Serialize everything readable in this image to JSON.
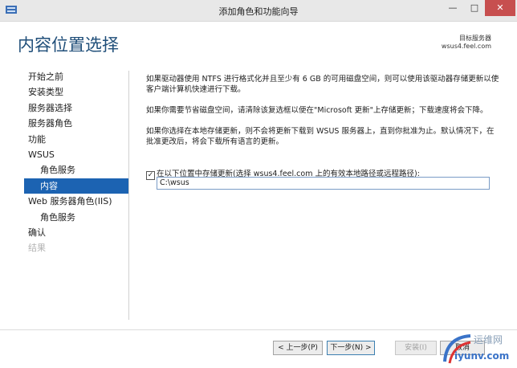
{
  "window": {
    "title": "添加角色和功能向导",
    "controls": {
      "minimize": "—",
      "maximize": "□",
      "close": "✕"
    }
  },
  "header": {
    "page_title": "内容位置选择",
    "destination_label": "目标服务器",
    "destination_server": "wsus4.feel.com"
  },
  "nav": {
    "items": [
      {
        "label": "开始之前"
      },
      {
        "label": "安装类型"
      },
      {
        "label": "服务器选择"
      },
      {
        "label": "服务器角色"
      },
      {
        "label": "功能"
      },
      {
        "label": "WSUS"
      },
      {
        "label": "角色服务"
      },
      {
        "label": "内容"
      },
      {
        "label": "Web 服务器角色(IIS)"
      },
      {
        "label": "角色服务"
      },
      {
        "label": "确认"
      },
      {
        "label": "结果"
      }
    ]
  },
  "content": {
    "para1": "如果驱动器使用 NTFS 进行格式化并且至少有 6 GB 的可用磁盘空间，则可以使用该驱动器存储更新以使客户端计算机快速进行下载。",
    "para2": "如果你需要节省磁盘空间，请清除该复选框以便在\"Microsoft 更新\"上存储更新；下载速度将会下降。",
    "para3": "如果你选择在本地存储更新，则不会将更新下载到 WSUS 服务器上，直到你批准为止。默认情况下，在批准更改后，将会下载所有语言的更新。",
    "checkbox_label": "在以下位置中存储更新(选择 wsus4.feel.com 上的有效本地路径或远程路径):",
    "checkbox_mark": "✓",
    "path_value": "C:\\wsus"
  },
  "buttons": {
    "prev": "< 上一步(P)",
    "next": "下一步(N) >",
    "install": "安装(I)",
    "cancel": "取消"
  },
  "watermark": {
    "text": "运维网",
    "url": "iyunv.com"
  }
}
